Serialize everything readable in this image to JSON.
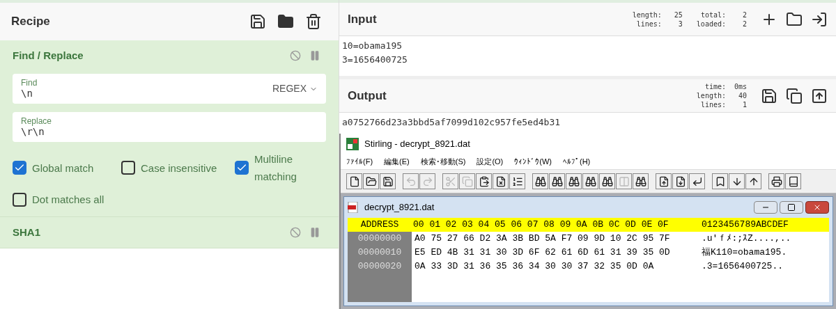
{
  "recipe": {
    "title": "Recipe",
    "operations": [
      {
        "name": "Find / Replace",
        "disabled": false,
        "paused": false,
        "fields": [
          {
            "label": "Find",
            "value": "\\n",
            "option": "REGEX"
          },
          {
            "label": "Replace",
            "value": "\\r\\n"
          }
        ],
        "options": [
          {
            "label": "Global match",
            "checked": true
          },
          {
            "label": "Case insensitive",
            "checked": false
          },
          {
            "label": "Multiline matching",
            "checked": true
          },
          {
            "label": "Dot matches all",
            "checked": false
          }
        ]
      },
      {
        "name": "SHA1",
        "disabled": false,
        "paused": false
      }
    ]
  },
  "input": {
    "title": "Input",
    "stats": [
      [
        {
          "label": "length:",
          "value": "25"
        },
        {
          "label": "lines:",
          "value": "3"
        }
      ],
      [
        {
          "label": "total:",
          "value": "2"
        },
        {
          "label": "loaded:",
          "value": "2"
        }
      ]
    ],
    "lines": [
      "10=obama195",
      "3=1656400725"
    ]
  },
  "output": {
    "title": "Output",
    "stats": [
      [
        {
          "label": "time:",
          "value": "0ms"
        },
        {
          "label": "length:",
          "value": "40"
        },
        {
          "label": "lines:",
          "value": "1"
        }
      ]
    ],
    "lines": [
      "a0752766d23a3bbd5af7099d102c957fe5ed4b31"
    ]
  },
  "stirling": {
    "title": "Stirling - decrypt_8921.dat",
    "menu": [
      "ﾌｧｲﾙ(F)",
      "編集(E)",
      "検索･移動(S)",
      "設定(O)",
      "ｳｨﾝﾄﾞｳ(W)",
      "ﾍﾙﾌﾟ(H)"
    ],
    "toolbar": [
      [
        {
          "kind": "new",
          "disabled": false
        },
        {
          "kind": "open",
          "disabled": false
        },
        {
          "kind": "save",
          "disabled": false
        }
      ],
      [
        {
          "kind": "undo",
          "disabled": true
        },
        {
          "kind": "redo",
          "disabled": true
        }
      ],
      [
        {
          "kind": "cut",
          "disabled": true
        },
        {
          "kind": "copy",
          "disabled": true
        },
        {
          "kind": "paste",
          "disabled": false
        },
        {
          "kind": "delete",
          "disabled": false
        },
        {
          "kind": "list",
          "disabled": false
        }
      ],
      [
        {
          "kind": "find",
          "disabled": false
        },
        {
          "kind": "find",
          "disabled": false
        },
        {
          "kind": "find",
          "disabled": false
        },
        {
          "kind": "find",
          "disabled": false
        },
        {
          "kind": "find",
          "disabled": false
        },
        {
          "kind": "compare",
          "disabled": true
        },
        {
          "kind": "find",
          "disabled": false
        }
      ],
      [
        {
          "kind": "page-up",
          "disabled": false
        },
        {
          "kind": "page-down",
          "disabled": false
        },
        {
          "kind": "page-return",
          "disabled": false
        }
      ],
      [
        {
          "kind": "mark",
          "disabled": false
        },
        {
          "kind": "mark-down",
          "disabled": false
        },
        {
          "kind": "mark-up",
          "disabled": false
        }
      ],
      [
        {
          "kind": "print",
          "disabled": false
        },
        {
          "kind": "book",
          "disabled": false
        }
      ]
    ],
    "document": {
      "title": "decrypt_8921.dat",
      "header": {
        "address": "ADDRESS",
        "bytes": "00 01 02 03 04 05 06 07 08 09 0A 0B 0C 0D 0E 0F",
        "text": "0123456789ABCDEF"
      },
      "rows": [
        {
          "address": "00000000",
          "bytes": "A0 75 27 66 D2 3A 3B BD 5A F7 09 9D 10 2C 95 7F",
          "text": ".u'ｆﾒ:;ｽZ....,.."
        },
        {
          "address": "00000010",
          "bytes": "E5 ED 4B 31 31 30 3D 6F 62 61 6D 61 31 39 35 0D",
          "text": "福K110=obama195."
        },
        {
          "address": "00000020",
          "bytes": "0A 33 3D 31 36 35 36 34 30 30 37 32 35 0D 0A",
          "text": ".3=1656400725.."
        }
      ]
    }
  }
}
